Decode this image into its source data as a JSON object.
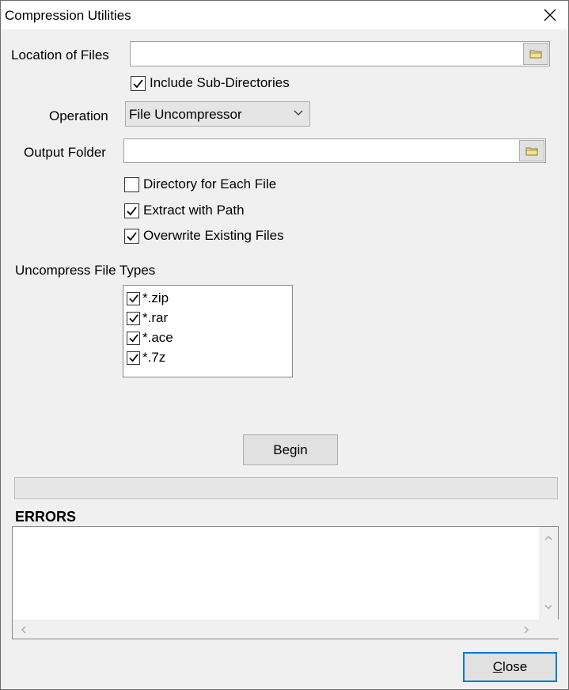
{
  "window": {
    "title": "Compression Utilities"
  },
  "location": {
    "label": "Location of Files",
    "value": ""
  },
  "include_sub": {
    "label": "Include Sub-Directories",
    "checked": true
  },
  "operation": {
    "label": "Operation",
    "selected": "File Uncompressor"
  },
  "output": {
    "label": "Output Folder",
    "value": ""
  },
  "options": [
    {
      "label": "Directory for Each File",
      "checked": false
    },
    {
      "label": "Extract with Path",
      "checked": true
    },
    {
      "label": "Overwrite Existing Files",
      "checked": true
    }
  ],
  "file_types": {
    "label": "Uncompress File Types",
    "items": [
      {
        "label": "*.zip",
        "checked": true
      },
      {
        "label": "*.rar",
        "checked": true
      },
      {
        "label": "*.ace",
        "checked": true
      },
      {
        "label": "*.7z",
        "checked": true
      }
    ]
  },
  "begin_button": {
    "label": "Begin"
  },
  "progress": {
    "value": 0
  },
  "errors": {
    "label": "ERRORS",
    "text": ""
  },
  "close_button": {
    "label_mnemonic": "C",
    "label_rest": "lose"
  },
  "icons": {
    "close": "close-icon",
    "folder": "folder-icon",
    "checkmark": "checkmark-icon",
    "dropdown": "chevron-down-icon"
  },
  "colors": {
    "accent": "#0078d7",
    "folder": "#e8d27a"
  }
}
